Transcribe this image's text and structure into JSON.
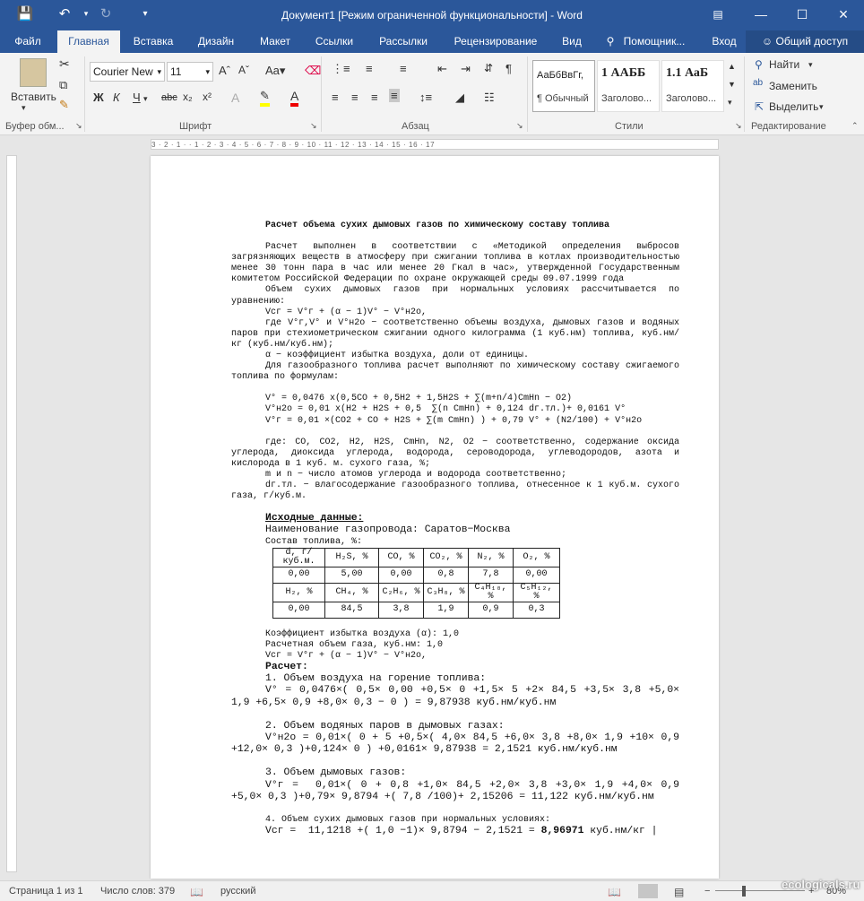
{
  "title_bar": {
    "title": "Документ1 [Режим ограниченной функциональности] - Word"
  },
  "tabs": [
    "Файл",
    "Главная",
    "Вставка",
    "Дизайн",
    "Макет",
    "Ссылки",
    "Рассылки",
    "Рецензирование",
    "Вид",
    "Помощник...",
    "Вход",
    "Общий доступ"
  ],
  "ribbon": {
    "paste_label": "Вставить",
    "clipboard_group": "Буфер обм...",
    "font_name": "Courier New",
    "font_size": "11",
    "font_group": "Шрифт",
    "paragraph_group": "Абзац",
    "styles": [
      {
        "preview": "АаБбВвГг,",
        "name": "¶ Обычный"
      },
      {
        "preview": "1 ААББ",
        "name": "Заголово..."
      },
      {
        "preview": "1.1 АаБ",
        "name": "Заголово..."
      }
    ],
    "styles_group": "Стили",
    "find": "Найти",
    "replace": "Заменить",
    "select": "Выделить",
    "editing_group": "Редактирование"
  },
  "ruler": "3 · 2 · 1 · · 1 · 2 · 3 · 4 · 5 · 6 · 7 · 8 · 9 · 10 · 11 · 12 · 13 · 14 · 15 · 16 · 17",
  "document": {
    "heading": "Расчет объема сухих дымовых газов по химическому составу топлива",
    "intro": "Расчет выполнен в соответствии с «Методикой определения выбросов загрязняющих веществ в атмосферу при сжигании топлива в котлах производительностью менее 30 тонн пара в час или менее 20 Гкал в час», утвержденной Государственным комитетом Российской Федерации по охране окружающей среды 09.07.1999 года",
    "volume_intro": "Объем сухих дымовых газов при нормальных условиях рассчитывается по уравнению:",
    "eq_main": "Vсг = V°г + (α − 1)V° − V°н2о,",
    "where1": "где V°г,V° и V°н2о − соответственно объемы воздуха, дымовых газов и водяных паров при стехиометрическом сжигании одного килограмма (1 куб.нм) топлива, куб.нм/кг (куб.нм/куб.нм);",
    "alpha_def": "α − коэффициент избытка воздуха, доли от единицы.",
    "gas_intro": "Для газообразного топлива расчет выполняют по химическому составу сжигаемого топлива по формулам:",
    "eq1": "V° = 0,0476 x(0,5CO + 0,5H2 + 1,5H2S + ∑(m+n/4)CmHn − O2)",
    "eq2": "V°н2о = 0,01 x(H2 + H2S + 0,5  ∑(n CmHn) + 0,124 dг.тл.)+ 0,0161 V°",
    "eq3": "V°г = 0,01 ×(CO2 + CO + H2S + ∑(m CmHn) ) + 0,79 V° + (N2/100) + V°н2о",
    "where2": "где: CO, CO2, H2, H2S, CmHn, N2, O2 − соответственно, содержание оксида углерода, диоксида углерода, водорода, сероводорода, углеводородов, азота и кислорода в 1 куб. м. сухого газа, %;",
    "mn_def": "m и n − число атомов углерода и водорода соответственно;",
    "d_def": "dг.тл. − влагосодержание газообразного топлива, отнесенное к 1 куб.м. сухого газа, г/куб.м.",
    "input_heading": "Исходные данные:",
    "pipeline": "Наименование газопровода: Саратов−Москва",
    "composition": "Состав топлива, %:",
    "table1_head": [
      "d, г/куб.м.",
      "H₂S, %",
      "CO, %",
      "CO₂, %",
      "N₂, %",
      "O₂, %"
    ],
    "table1_vals": [
      "0,00",
      "5,00",
      "0,00",
      "0,8",
      "7,8",
      "0,00"
    ],
    "table2_head": [
      "H₂, %",
      "CH₄, %",
      "C₂H₆, %",
      "C₃H₈, %",
      "C₄H₁₀, %",
      "C₅H₁₂, %"
    ],
    "table2_vals": [
      "0,00",
      "84,5",
      "3,8",
      "1,9",
      "0,9",
      "0,3"
    ],
    "alpha_val": "Коэффициент избытка воздуха (α): 1,0",
    "gas_vol": "Расчетная объем газа, куб.нм: 1,0",
    "eq_main2": "Vсг = V°г + (α − 1)V° − V°н2о,",
    "calc_heading": "Расчет:",
    "s1_title": "1. Объем воздуха на горение топлива:",
    "s1_body": "V° = 0,0476×( 0,5× 0,00 +0,5× 0 +1,5× 5 +2× 84,5 +3,5× 3,8 +5,0× 1,9 +6,5× 0,9 +8,0× 0,3 − 0 ) = 9,87938 куб.нм/куб.нм",
    "s2_title": "2. Объем водяных паров в дымовых газах:",
    "s2_body": "V°н2о = 0,01×( 0 + 5 +0,5×( 4,0× 84,5 +6,0× 3,8 +8,0× 1,9 +10× 0,9 +12,0× 0,3 )+0,124× 0 ) +0,0161× 9,87938 = 2,1521 куб.нм/куб.нм",
    "s3_title": "3. Объем дымовых газов:",
    "s3_body": "V°г =  0,01×( 0 + 0,8 +1,0× 84,5 +2,0× 3,8 +3,0× 1,9 +4,0× 0,9 +5,0× 0,3 )+0,79× 9,8794 +( 7,8 /100)+ 2,15206 = 11,122 куб.нм/куб.нм",
    "s4_title": "4. Объем сухих дымовых газов при нормальных условиях:",
    "s4_body_a": "Vсг =  11,1218 +( 1,0 −1)× 9,8794 − 2,1521 = ",
    "s4_result": "8,96971",
    "s4_unit": " куб.нм/кг |"
  },
  "status": {
    "page": "Страница 1 из 1",
    "words": "Число слов: 379",
    "lang": "русский",
    "zoom": "80%",
    "watermark": "ecologicals.ru"
  }
}
